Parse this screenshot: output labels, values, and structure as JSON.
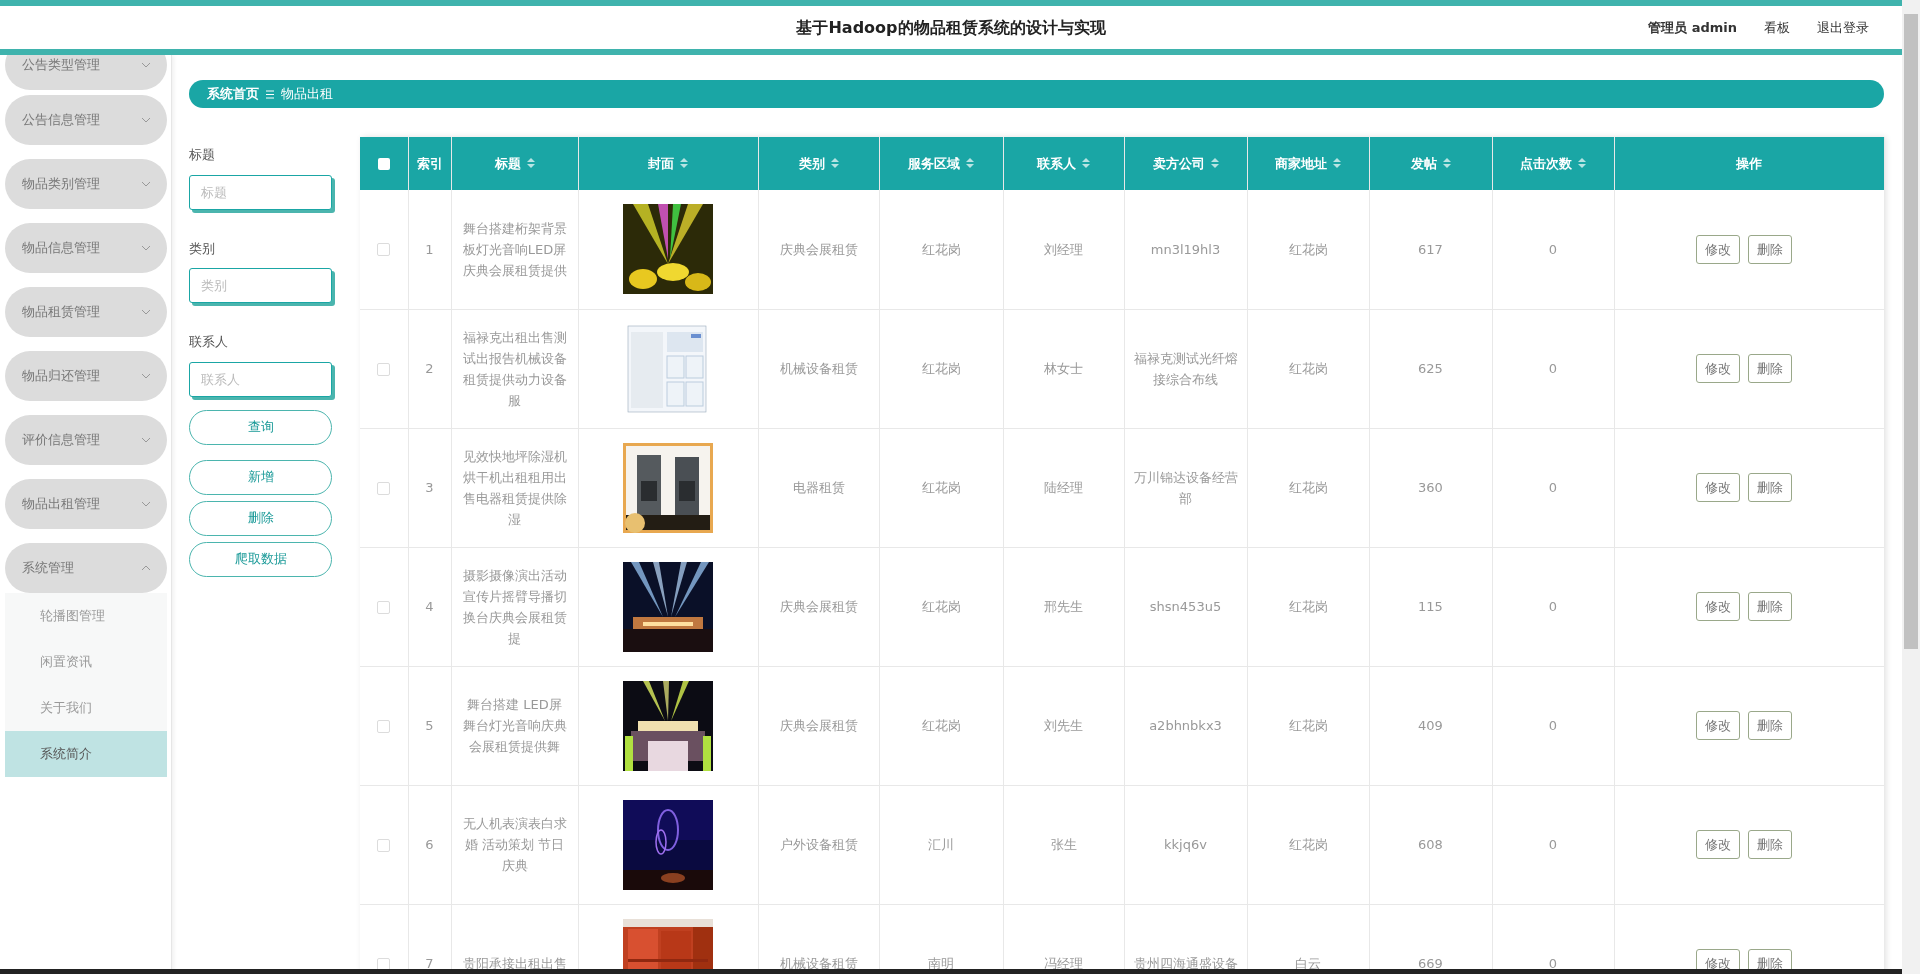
{
  "header": {
    "title": "基于Hadoop的物品租赁系统的设计与实现",
    "user": "管理员 admin",
    "links": [
      "看板",
      "退出登录"
    ]
  },
  "sidebar": {
    "items": [
      {
        "label": "公告类型管理",
        "expanded": false
      },
      {
        "label": "公告信息管理",
        "expanded": false
      },
      {
        "label": "物品类别管理",
        "expanded": false
      },
      {
        "label": "物品信息管理",
        "expanded": false
      },
      {
        "label": "物品租赁管理",
        "expanded": false
      },
      {
        "label": "物品归还管理",
        "expanded": false
      },
      {
        "label": "评价信息管理",
        "expanded": false
      },
      {
        "label": "物品出租管理",
        "expanded": false
      },
      {
        "label": "系统管理",
        "expanded": true,
        "children": [
          {
            "label": "轮播图管理",
            "selected": false
          },
          {
            "label": "闲置资讯",
            "selected": false
          },
          {
            "label": "关于我们",
            "selected": false
          },
          {
            "label": "系统简介",
            "selected": true
          }
        ]
      }
    ]
  },
  "breadcrumb": [
    "系统首页",
    "物品出租"
  ],
  "search": {
    "fields": [
      {
        "label": "标题",
        "placeholder": "标题"
      },
      {
        "label": "类别",
        "placeholder": "类别"
      },
      {
        "label": "联系人",
        "placeholder": "联系人"
      }
    ],
    "buttons": [
      "查询",
      "新增",
      "删除",
      "爬取数据"
    ]
  },
  "table": {
    "select_all": {
      "checked": false
    },
    "columns": [
      {
        "label": "索引",
        "sortable": false
      },
      {
        "label": "标题",
        "sortable": true
      },
      {
        "label": "封面",
        "sortable": true
      },
      {
        "label": "类别",
        "sortable": true
      },
      {
        "label": "服务区域",
        "sortable": true
      },
      {
        "label": "联系人",
        "sortable": true
      },
      {
        "label": "卖方公司",
        "sortable": true
      },
      {
        "label": "商家地址",
        "sortable": true
      },
      {
        "label": "发帖",
        "sortable": true
      },
      {
        "label": "点击次数",
        "sortable": true
      },
      {
        "label": "操作",
        "sortable": false
      }
    ],
    "rows": [
      {
        "checked": false,
        "index": "1",
        "title": "舞台搭建桁架背景板灯光音响LED屏庆典会展租赁提供",
        "category": "庆典会展租赁",
        "area": "红花岗",
        "contact": "刘经理",
        "company": "mn3l19hl3",
        "address": "红花岗",
        "posts": "617",
        "clicks": "0",
        "actions": [
          "修改",
          "删除"
        ]
      },
      {
        "checked": false,
        "index": "2",
        "title": "福禄克出租出售测试出报告机械设备租赁提供动力设备服",
        "category": "机械设备租赁",
        "area": "红花岗",
        "contact": "林女士",
        "company": "福禄克测试光纤熔接综合布线",
        "address": "红花岗",
        "posts": "625",
        "clicks": "0",
        "actions": [
          "修改",
          "删除"
        ]
      },
      {
        "checked": false,
        "index": "3",
        "title": "见效快地坪除湿机烘干机出租租用出售电器租赁提供除湿",
        "category": "电器租赁",
        "area": "红花岗",
        "contact": "陆经理",
        "company": "万川锦达设备经营部",
        "address": "红花岗",
        "posts": "360",
        "clicks": "0",
        "actions": [
          "修改",
          "删除"
        ]
      },
      {
        "checked": false,
        "index": "4",
        "title": "摄影摄像演出活动宣传片摇臂导播切换台庆典会展租赁提",
        "category": "庆典会展租赁",
        "area": "红花岗",
        "contact": "邢先生",
        "company": "shsn453u5",
        "address": "红花岗",
        "posts": "115",
        "clicks": "0",
        "actions": [
          "修改",
          "删除"
        ]
      },
      {
        "checked": false,
        "index": "5",
        "title": "舞台搭建 LED屏舞台灯光音响庆典会展租赁提供舞",
        "category": "庆典会展租赁",
        "area": "红花岗",
        "contact": "刘先生",
        "company": "a2bhnbkx3",
        "address": "红花岗",
        "posts": "409",
        "clicks": "0",
        "actions": [
          "修改",
          "删除"
        ]
      },
      {
        "checked": false,
        "index": "6",
        "title": "无人机表演表白求婚 活动策划 节日庆典",
        "category": "户外设备租赁",
        "area": "汇川",
        "contact": "张生",
        "company": "kkjq6v",
        "address": "红花岗",
        "posts": "608",
        "clicks": "0",
        "actions": [
          "修改",
          "删除"
        ]
      },
      {
        "checked": false,
        "index": "7",
        "title": "贵阳承接出租出售",
        "category": "机械设备租赁",
        "area": "南明",
        "contact": "冯经理",
        "company": "贵州四海通盛设备",
        "address": "白云",
        "posts": "669",
        "clicks": "0",
        "actions": [
          "修改",
          "删除"
        ]
      }
    ]
  }
}
